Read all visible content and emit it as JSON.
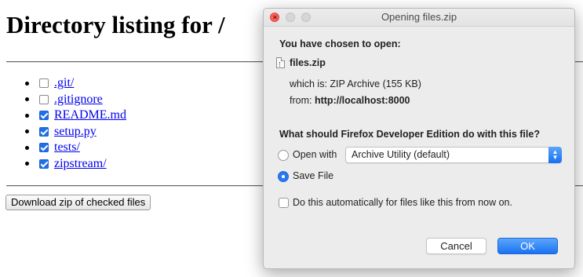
{
  "page": {
    "heading": "Directory listing for /",
    "files": [
      {
        "name": ".git/",
        "checked": false
      },
      {
        "name": ".gitignore",
        "checked": false
      },
      {
        "name": "README.md",
        "checked": true
      },
      {
        "name": "setup.py",
        "checked": true
      },
      {
        "name": "tests/",
        "checked": true
      },
      {
        "name": "zipstream/",
        "checked": true
      }
    ],
    "download_button": "Download zip of checked files"
  },
  "dialog": {
    "window_title": "Opening files.zip",
    "chosen_label": "You have chosen to open:",
    "file_icon": "zip-file-icon",
    "file_name": "files.zip",
    "which_is_label": "which is:",
    "which_is_value": "ZIP Archive (155 KB)",
    "from_label": "from:",
    "from_value": "http://localhost:8000",
    "question": "What should Firefox Developer Edition do with this file?",
    "open_with_label": "Open with",
    "open_with_selected": false,
    "app_select_value": "Archive Utility (default)",
    "save_file_label": "Save File",
    "save_file_selected": true,
    "auto_label": "Do this automatically for files like this from now on.",
    "auto_checked": false,
    "cancel_label": "Cancel",
    "ok_label": "OK"
  },
  "colors": {
    "link": "#0000ee",
    "accent": "#1f6fe5",
    "close_button": "#fc605c"
  }
}
